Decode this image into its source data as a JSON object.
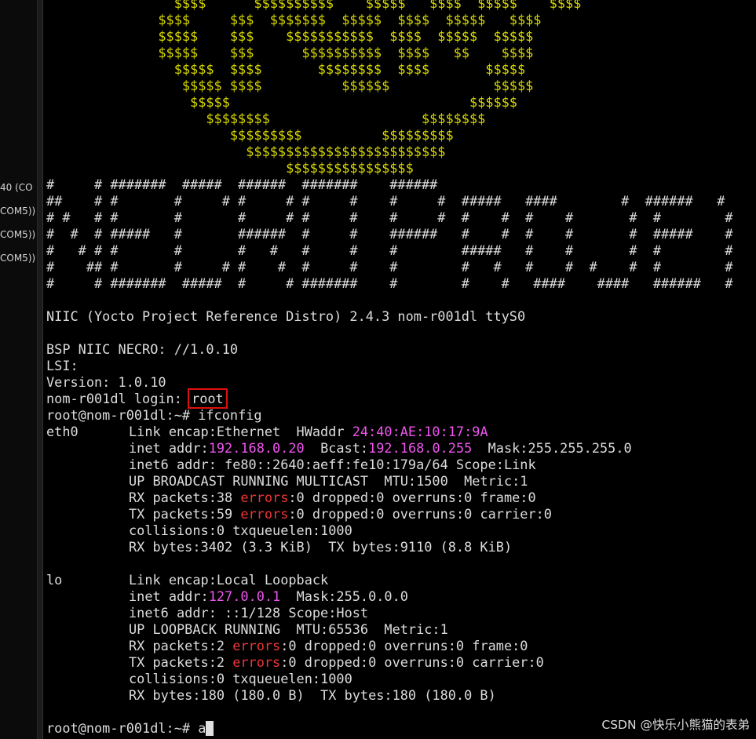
{
  "sidebar": {
    "tabs": [
      "40 (CO",
      "COM5))",
      "COM5))",
      "COM5))"
    ]
  },
  "terminal": {
    "art_dollar": [
      "                $$$$      $$$$$$$$$$    $$$$$   $$$$  $$$$$    $$$$",
      "              $$$$     $$$  $$$$$$$  $$$$$  $$$$  $$$$$   $$$$",
      "              $$$$$    $$$    $$$$$$$$$$$  $$$$  $$$$$  $$$$$",
      "              $$$$$    $$$      $$$$$$$$$$  $$$$   $$    $$$$",
      "                $$$$$  $$$$       $$$$$$$$  $$$$       $$$$$",
      "                 $$$$$ $$$$          $$$$$$             $$$$$",
      "                  $$$$$                              $$$$$$",
      "                    $$$$$$$$                   $$$$$$$$",
      "                       $$$$$$$$$          $$$$$$$$$",
      "                         $$$$$$$$$$$$$$$$$$$$$$$$$",
      "                              $$$$$$$$$$$$$$$$"
    ],
    "art_hash": [
      "#     # #######  #####  ######  #######    ######",
      "##    # #       #     # #     # #     #    #     #  #####   ####        #  ######   #",
      "# #   # #       #       #     # #     #    #     #  #    #  #    #       #  #        #",
      "#  #  # #####   #       ######  #     #    ######   #    #  #    #       #  #####    #",
      "#   # # #       #       #   #   #     #    #        #####   #    #       #  #        #",
      "#    ## #       #     # #    #  #     #    #        #   #   #    #  #    #  #        #",
      "#     # #######  #####  #     # #######    #        #    #   ####    ####   ######   #"
    ],
    "banner": "NIIC (Yocto Project Reference Distro) 2.4.3 nom-r001dl ttyS0",
    "bsp": "BSP NIIC NECRO: //1.0.10",
    "lsi": "LSI:",
    "version": "Version: 1.0.10",
    "login_prompt": "nom-r001dl login: ",
    "login_user": "root",
    "cmd1_prompt": "root@nom-r001dl:~# ",
    "cmd1": "ifconfig",
    "eth0": {
      "iface": "eth0",
      "l1_a": "Link encap:Ethernet  HWaddr ",
      "hwaddr": "24:40:AE:10:17:9A",
      "l2_a": "inet addr:",
      "ip": "192.168.0.20",
      "l2_b": "  Bcast:",
      "bcast": "192.168.0.255",
      "l2_c": "  Mask:255.255.255.0",
      "l3": "inet6 addr: fe80::2640:aeff:fe10:179a/64 Scope:Link",
      "l4": "UP BROADCAST RUNNING MULTICAST  MTU:1500  Metric:1",
      "l5_a": "RX packets:38 ",
      "l5_b": ":0 dropped:0 overruns:0 frame:0",
      "l6_a": "TX packets:59 ",
      "l6_b": ":0 dropped:0 overruns:0 carrier:0",
      "l7": "collisions:0 txqueuelen:1000",
      "l8": "RX bytes:3402 (3.3 KiB)  TX bytes:9110 (8.8 KiB)"
    },
    "lo": {
      "iface": "lo",
      "l1": "Link encap:Local Loopback",
      "l2_a": "inet addr:",
      "ip": "127.0.0.1",
      "l2_b": "  Mask:255.0.0.0",
      "l3": "inet6 addr: ::1/128 Scope:Host",
      "l4": "UP LOOPBACK RUNNING  MTU:65536  Metric:1",
      "l5_a": "RX packets:2 ",
      "l5_b": ":0 dropped:0 overruns:0 frame:0",
      "l6_a": "TX packets:2 ",
      "l6_b": ":0 dropped:0 overruns:0 carrier:0",
      "l7": "collisions:0 txqueuelen:1000",
      "l8": "RX bytes:180 (180.0 B)  TX bytes:180 (180.0 B)"
    },
    "errors_word": "errors",
    "cmd2_prompt": "root@nom-r001dl:~# ",
    "cmd2_input": "a"
  },
  "watermark": "CSDN @快乐小熊猫的表弟",
  "colors": {
    "background": "#000000",
    "text": "#dcdcdc",
    "art_yellow": "#d9d900",
    "value_magenta": "#ee55ee",
    "error_red": "#ee3535",
    "highlight_box": "#e01010"
  }
}
